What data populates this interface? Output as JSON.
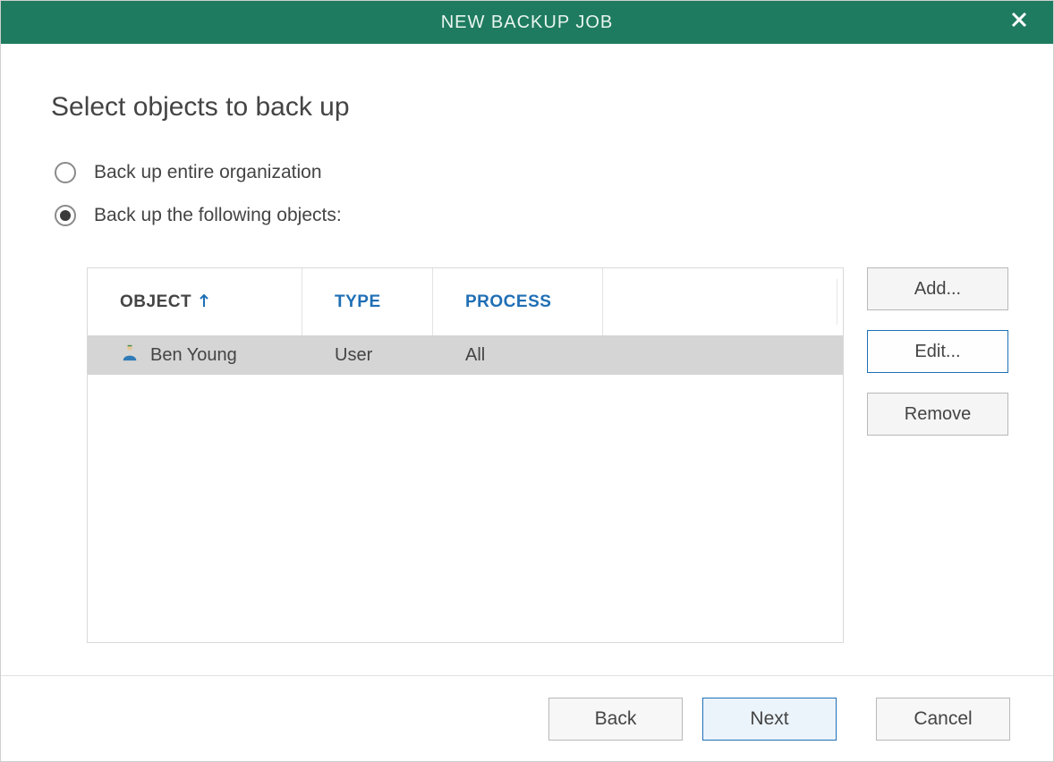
{
  "dialog": {
    "title": "NEW BACKUP JOB",
    "heading": "Select objects to back up"
  },
  "options": {
    "entire_org": "Back up entire organization",
    "following_objects": "Back up the following objects:",
    "selected": "following_objects"
  },
  "table": {
    "headers": {
      "object": "OBJECT",
      "type": "TYPE",
      "process": "PROCESS"
    },
    "sort": {
      "column": "object",
      "direction": "asc"
    },
    "rows": [
      {
        "object": "Ben Young",
        "type": "User",
        "process": "All",
        "selected": true,
        "icon": "user"
      }
    ]
  },
  "side_buttons": {
    "add": "Add...",
    "edit": "Edit...",
    "remove": "Remove"
  },
  "footer": {
    "back": "Back",
    "next": "Next",
    "cancel": "Cancel"
  },
  "colors": {
    "accent_green": "#1f7b5f",
    "link_blue": "#1f6fb5"
  }
}
